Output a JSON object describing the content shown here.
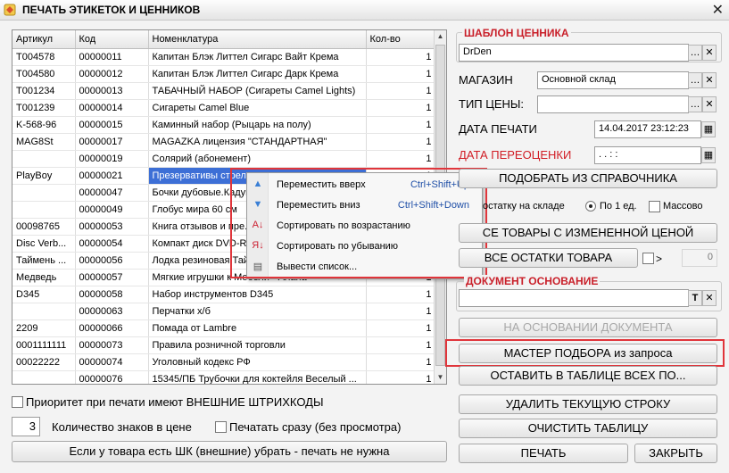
{
  "window": {
    "title": "ПЕЧАТЬ ЭТИКЕТОК И ЦЕННИКОВ",
    "close": "✕"
  },
  "table": {
    "headers": [
      "Артикул",
      "Код",
      "Номенклатура",
      "Кол-во"
    ],
    "rows": [
      [
        "T004578",
        "00000011",
        "Капитан Блэк Литтел Сигарс Вайт Крема",
        "1"
      ],
      [
        "T004580",
        "00000012",
        "Капитан Блэк Литтел Сигарс Дарк Крема",
        "1"
      ],
      [
        "T001234",
        "00000013",
        "ТАБАЧНЫЙ НАБОР (Сигареты Camel Lights)",
        "1"
      ],
      [
        "T001239",
        "00000014",
        "Сигареты Camel Blue",
        "1"
      ],
      [
        "K-568-96",
        "00000015",
        "Каминный набор (Рыцарь на полу)",
        "1"
      ],
      [
        "MAG8St",
        "00000017",
        "MAGAZKA лицензия \"СТАНДАРТНАЯ\"",
        "1"
      ],
      [
        "",
        "00000019",
        "Солярий (абонемент)",
        "1"
      ],
      [
        "PlayBoy",
        "00000021",
        "Презервативы стрел...",
        "1"
      ],
      [
        "",
        "00000047",
        "Бочки дубовые.Кадуш...",
        "1"
      ],
      [
        "",
        "00000049",
        "Глобус мира 60 см",
        "1"
      ],
      [
        "00098765",
        "00000053",
        "Книга отзывов и пре...",
        "1"
      ],
      [
        "Disc Verb...",
        "00000054",
        "Компакт диск DVD-R...",
        "1"
      ],
      [
        "Таймень ...",
        "00000056",
        "Лодка резиновая Тай...",
        "1"
      ],
      [
        "Медведь",
        "00000057",
        "Мягкие игрушки к Мебели - Алана",
        "1"
      ],
      [
        "D345",
        "00000058",
        "Набор инструментов D345",
        "1"
      ],
      [
        "",
        "00000063",
        "Перчатки х/б",
        "1"
      ],
      [
        "2209",
        "00000066",
        "Помада от Lambre",
        "1"
      ],
      [
        "0001111111",
        "00000073",
        "Правила розничной торговли",
        "1"
      ],
      [
        "00022222",
        "00000074",
        "Уголовный кодекс РФ",
        "1"
      ],
      [
        "",
        "00000076",
        "15345/ПБ Трубочки для коктейля Веселый ...",
        "1"
      ]
    ]
  },
  "context_menu": [
    {
      "icon": "move-up-icon",
      "glyph": "▲",
      "label": "Переместить вверх",
      "shortcut": "Ctrl+Shift+Up"
    },
    {
      "icon": "move-down-icon",
      "glyph": "▼",
      "label": "Переместить вниз",
      "shortcut": "Ctrl+Shift+Down"
    },
    {
      "icon": "sort-asc-icon",
      "glyph": "А↓",
      "label": "Сортировать по возрастанию",
      "shortcut": ""
    },
    {
      "icon": "sort-desc-icon",
      "glyph": "Я↓",
      "label": "Сортировать по убыванию",
      "shortcut": ""
    },
    {
      "icon": "export-list-icon",
      "glyph": "▤",
      "label": "Вывести список...",
      "shortcut": ""
    }
  ],
  "bottom_left": {
    "priority_label": "Приоритет при печати имеют ВНЕШНИЕ ШТРИХКОДЫ",
    "digits_value": "3",
    "digits_label": "Количество знаков в цене",
    "print_now_label": "Печатать сразу (без просмотра)",
    "remove_button": "Если у товара есть ШК (внешние) убрать - печать не нужна"
  },
  "template": {
    "header": "ШАБЛОН ЦЕННИКА",
    "value": "DrDen",
    "store_label": "МАГАЗИН",
    "store_value": "Основной склад",
    "price_type_label": "ТИП ЦЕНЫ:",
    "price_type_value": "",
    "print_date_label": "ДАТА ПЕЧАТИ",
    "print_date_value": "14.04.2017 23:12:23",
    "reprice_date_label": "ДАТА ПЕРЕОЦЕНКИ",
    "reprice_date_value": ". .   : :"
  },
  "actions": {
    "pick_from_catalog": "ПОДОБРАТЬ ИЗ СПРАВОЧНИКА",
    "stock_label": "остатку на складе",
    "per_unit_label": "По 1 ед.",
    "bulk_label": "Массово",
    "changed_price": "СЕ ТОВАРЫ С ИЗМЕНЕННОЙ ЦЕНОЙ",
    "all_stock": "ВСЕ ОСТАТКИ ТОВАРА",
    "gt_label": ">",
    "gt_value": "0"
  },
  "doc_basis": {
    "header": "ДОКУМЕНТ ОСНОВАНИЕ",
    "value": "",
    "on_basis": "НА ОСНОВАНИИ ДОКУМЕНТА",
    "wizard": "МАСТЕР ПОДБОРА из запроса",
    "keep_all": "ОСТАВИТЬ В ТАБЛИЦЕ ВСЕХ ПО...",
    "delete_row": "УДАЛИТЬ ТЕКУЩУЮ СТРОКУ",
    "clear_table": "ОЧИСТИТЬ ТАБЛИЦУ",
    "print": "ПЕЧАТЬ",
    "close": "ЗАКРЫТЬ"
  },
  "colors": {
    "accent_red": "#d11d25",
    "selection": "#3d6fd6",
    "highlight_box": "#e0353b"
  }
}
